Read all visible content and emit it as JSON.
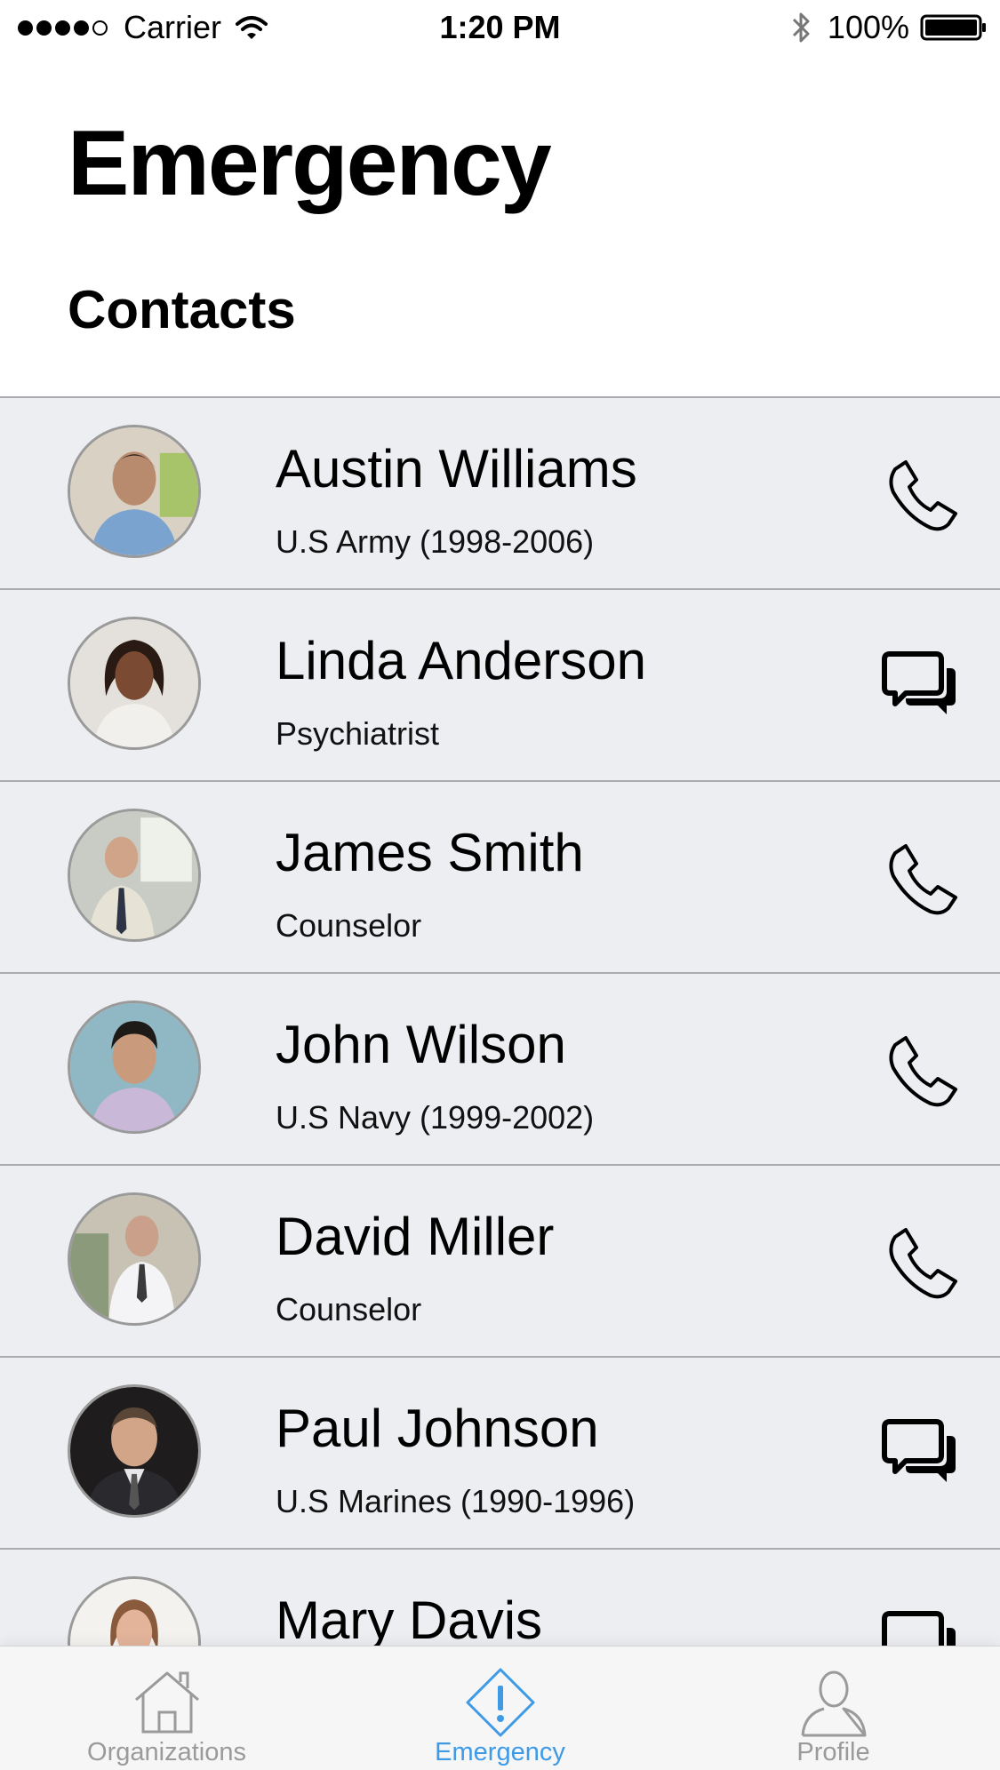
{
  "status_bar": {
    "carrier": "Carrier",
    "time": "1:20 PM",
    "battery": "100%"
  },
  "header": {
    "title": "Emergency",
    "section": "Contacts"
  },
  "contacts": [
    {
      "name": "Austin Williams",
      "role": "U.S Army (1998-2006)",
      "action": "phone-icon"
    },
    {
      "name": "Linda Anderson",
      "role": "Psychiatrist",
      "action": "chat-icon"
    },
    {
      "name": "James Smith",
      "role": "Counselor",
      "action": "phone-icon"
    },
    {
      "name": "John Wilson",
      "role": "U.S Navy (1999-2002)",
      "action": "phone-icon"
    },
    {
      "name": "David Miller",
      "role": "Counselor",
      "action": "phone-icon"
    },
    {
      "name": "Paul Johnson",
      "role": "U.S Marines (1990-1996)",
      "action": "chat-icon"
    },
    {
      "name": "Mary Davis",
      "role": "",
      "action": "chat-icon"
    }
  ],
  "tab_bar": {
    "items": [
      {
        "label": "Organizations",
        "icon": "home-icon",
        "active": false
      },
      {
        "label": "Emergency",
        "icon": "alert-icon",
        "active": true
      },
      {
        "label": "Profile",
        "icon": "person-icon",
        "active": false
      }
    ]
  },
  "colors": {
    "accent": "#3f9ae6",
    "row_background": "#eceef2",
    "inactive_tab": "#9a9a9a"
  }
}
